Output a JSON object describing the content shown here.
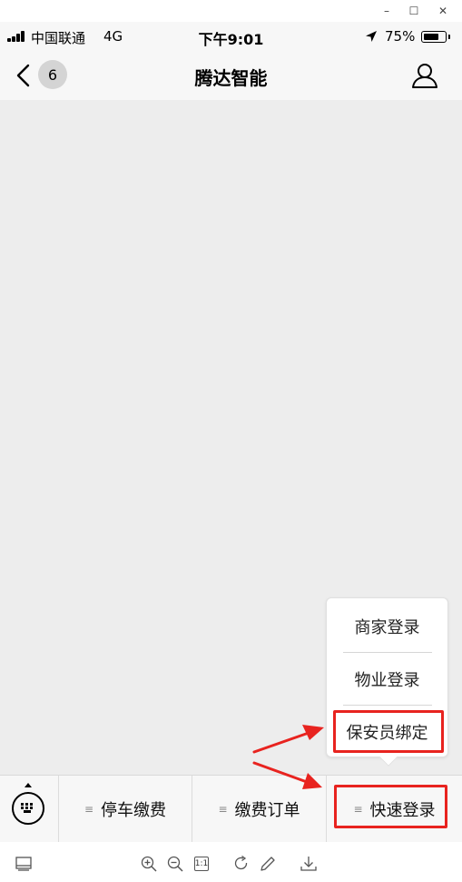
{
  "window": {
    "minimize_glyph": "–",
    "maximize_glyph": "☐",
    "close_glyph": "✕"
  },
  "status_bar": {
    "carrier": "中国联通",
    "network": "4G",
    "time": "下午9:01",
    "battery_percent": "75%",
    "battery_level": 0.75
  },
  "nav": {
    "back_count": "6",
    "title": "腾达智能",
    "icons": [
      "chevron-left-icon",
      "user-icon"
    ]
  },
  "popup": {
    "items": [
      "商家登录",
      "物业登录",
      "保安员绑定"
    ]
  },
  "menu": {
    "glyph": "≡",
    "items": [
      "停车缴费",
      "缴费订单",
      "快速登录"
    ]
  },
  "toolbar": {
    "one_to_one": "1:1",
    "icons": [
      "panel-icon",
      "zoom-in-icon",
      "zoom-out-icon",
      "actual-size-icon",
      "rotate-icon",
      "edit-icon",
      "download-icon"
    ]
  },
  "colors": {
    "highlight": "#e8231f",
    "content_bg": "#ededed",
    "bar_bg": "#f7f7f7"
  }
}
